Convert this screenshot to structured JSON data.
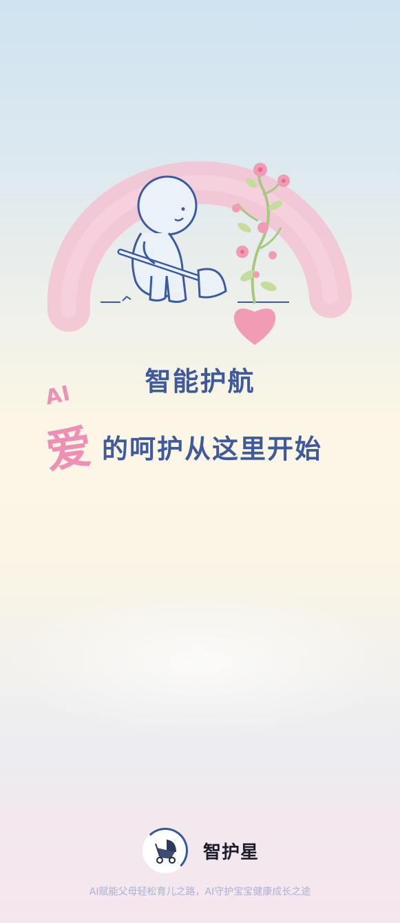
{
  "hero": {
    "title": "智能护航",
    "ai_tag": "AI",
    "love_char": "爱",
    "subtitle": "的呵护从这里开始"
  },
  "brand": {
    "logo_icon": "stroller-icon",
    "name": "智护星",
    "tagline": "AI赋能父母轻松育儿之路，AI守护宝宝健康成长之途"
  },
  "colors": {
    "primary_text": "#3f5a9c",
    "accent_pink": "#ef8fb3",
    "rainbow_pink": "#f4c2d2",
    "tagline": "#a6b2d8"
  }
}
